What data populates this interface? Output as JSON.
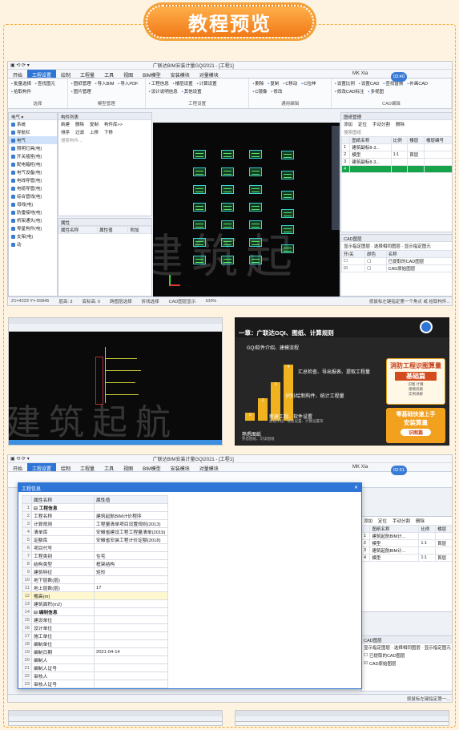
{
  "banner": {
    "title": "教程预览"
  },
  "shot1": {
    "window_title": "广联达BIM安装计量GQI2021 - [工程1]",
    "tabs": [
      "开始",
      "工程设置",
      "绘制",
      "工程量",
      "工具",
      "视图",
      "BIM模型",
      "安装模块",
      "对量模块"
    ],
    "active_tab": "工程设置",
    "user": "MK Xia",
    "time": "03:40",
    "ribbon_groups": [
      {
        "name": "选择",
        "items": [
          "批量选择",
          "查找图元",
          "拾取构件"
        ]
      },
      {
        "name": "模型管理",
        "items": [
          "图纸管理",
          "导入BIM",
          "导入PDF",
          "图片管理"
        ]
      },
      {
        "name": "工程设置",
        "items": [
          "工程信息",
          "楼层设置",
          "计算设置",
          "设计说明信息",
          "其他设置"
        ]
      },
      {
        "name": "通用编辑",
        "items": [
          "删除",
          "复制",
          "C移动",
          "C拉伸",
          "C镜像",
          "修改"
        ]
      },
      {
        "name": "CAD编辑",
        "items": [
          "设置比例",
          "设置CAD",
          "查找替换",
          "补画CAD",
          "修改CAD标注",
          "多视图"
        ]
      }
    ],
    "filters": [
      "电气"
    ],
    "tree": [
      "系统",
      "导航栏",
      "电气",
      "照明灯具(电)",
      "开关插座(电)",
      "配电箱柜(电)",
      "电气设备(电)",
      "电线导管(电)",
      "电缆导管(电)",
      "综合管线(电)",
      "母线(电)",
      "防雷接地(电)",
      "桥架通头(电)",
      "零星构件(电)",
      "支架(电)",
      "动"
    ],
    "component_list_title": "构件列表",
    "component_list_tools": [
      "新建",
      "删除",
      "复制",
      "构件库>>"
    ],
    "sort_tools": [
      "排序",
      "过滤",
      "上移",
      "下移"
    ],
    "search_placeholder": "搜索构件...",
    "property_title": "属性",
    "property_cols": [
      "属性名称",
      "属性值",
      "附加"
    ],
    "drawing_panel_title": "图纸管理",
    "drawing_tools": [
      "添加",
      "定位",
      "手动分割",
      "删除"
    ],
    "search_label": "搜索图纸",
    "drawing_cols": [
      "图纸名称",
      "比例",
      "楼层",
      "楼层编号"
    ],
    "drawing_rows": [
      {
        "n": "1",
        "name": "建筑副标8-3...",
        "scale": "",
        "floor": "",
        "code": ""
      },
      {
        "n": "2",
        "name": "模型",
        "scale": "1:1",
        "floor": "首层",
        "code": ""
      },
      {
        "n": "3",
        "name": "建筑副标8-3...",
        "scale": "",
        "floor": "",
        "code": ""
      },
      {
        "n": "4",
        "name": "",
        "scale": "",
        "floor": "",
        "code": ""
      }
    ],
    "cad_layer_title": "CAD图层",
    "cad_layer_opts": "显示指定图层 · 选择相同图层 · 显示指定图元",
    "cad_layer_cols": [
      "开/关",
      "颜色",
      "名称"
    ],
    "cad_layers": [
      "已提取的CAD图层",
      "CAD原始图层"
    ],
    "status": [
      "Z1=4223 Y=-55846",
      "层高: 3",
      "底标高: 0",
      "跨图层选择",
      "折线选择",
      "CAD图层显示",
      "100%"
    ],
    "status_right": "按鼠标左键指定第一个角点 或 拾取构件..."
  },
  "shot2": {
    "watermark": "建筑起航"
  },
  "shot3": {
    "header": "一章：广联达GQI、图纸、计算规则",
    "subheader": "GQI软件介绍、建模流程",
    "steps": [
      {
        "n": "1",
        "label": "熟悉图纸",
        "sub": "熟悉图纸、识读图纸"
      },
      {
        "n": "2",
        "label": "新建工程、软件设置",
        "sub": "新建工程、楼层设置、计算设置等"
      },
      {
        "n": "3",
        "label": "识别/绘制构件、统计工程量",
        "sub": ""
      },
      {
        "n": "4",
        "label": "汇总检查、导出报表、提取工程量",
        "sub": ""
      }
    ],
    "promo_title": "消防工程识图算量",
    "promo_sub": "基础篇",
    "promo_items": [
      "识图 计算",
      "建模思路",
      "实例讲解"
    ],
    "promo2_title": "零基础快速上手",
    "promo2_sub": "安装算量",
    "promo2_btn": "识图篇"
  },
  "shot4": {
    "window_title": "广联达BIM安装计量GQI2021 - [工程1]",
    "tabs": [
      "开始",
      "工程设置",
      "绘制",
      "工程量",
      "工具",
      "视图",
      "BIM模型",
      "安装模块",
      "对量模块"
    ],
    "user": "MK Xia",
    "time": "02:51",
    "dialog_title": "工程信息",
    "columns": [
      "属性名称",
      "属性值"
    ],
    "rows": [
      {
        "n": "1",
        "name": "工程信息",
        "val": "",
        "grp": true
      },
      {
        "n": "2",
        "name": "工程名称",
        "val": "建筑起航BIM计价程序"
      },
      {
        "n": "3",
        "name": "计算规则",
        "val": "工程量清单项目设置规则(2013)"
      },
      {
        "n": "4",
        "name": "清单库",
        "val": "安徽省建设工程工程量清单(2019)"
      },
      {
        "n": "5",
        "name": "定额库",
        "val": "安徽省安装工程计价定额(2018)"
      },
      {
        "n": "6",
        "name": "项目代号",
        "val": ""
      },
      {
        "n": "7",
        "name": "工程类别",
        "val": "住宅"
      },
      {
        "n": "8",
        "name": "结构类型",
        "val": "框架结构"
      },
      {
        "n": "9",
        "name": "建筑特征",
        "val": "矩形"
      },
      {
        "n": "10",
        "name": "地下层数(层)",
        "val": ""
      },
      {
        "n": "11",
        "name": "地上层数(层)",
        "val": "17"
      },
      {
        "n": "12",
        "name": "檐高(m)",
        "val": "",
        "hl": true
      },
      {
        "n": "13",
        "name": "建筑面积(m2)",
        "val": ""
      },
      {
        "n": "14",
        "name": "编制信息",
        "val": "",
        "grp": true
      },
      {
        "n": "15",
        "name": "建设单位",
        "val": ""
      },
      {
        "n": "16",
        "name": "设计单位",
        "val": ""
      },
      {
        "n": "17",
        "name": "施工单位",
        "val": ""
      },
      {
        "n": "18",
        "name": "编制单位",
        "val": ""
      },
      {
        "n": "19",
        "name": "编制日期",
        "val": "2021-04-14"
      },
      {
        "n": "20",
        "name": "编制人",
        "val": ""
      },
      {
        "n": "21",
        "name": "编制人证号",
        "val": ""
      },
      {
        "n": "22",
        "name": "审核人",
        "val": ""
      },
      {
        "n": "23",
        "name": "审核人证号",
        "val": ""
      }
    ],
    "drawing_cols": [
      "图纸名称",
      "比例",
      "楼层"
    ],
    "drawing_rows": [
      {
        "n": "1",
        "name": "建筑起航BIM计...",
        "scale": "",
        "floor": ""
      },
      {
        "n": "2",
        "name": "模型",
        "scale": "1:1",
        "floor": "首层"
      },
      {
        "n": "3",
        "name": "建筑起航BIM计...",
        "scale": "",
        "floor": ""
      },
      {
        "n": "4",
        "name": "模型",
        "scale": "1:1",
        "floor": "首层"
      }
    ],
    "drawing_tools": [
      "添加",
      "定位",
      "手动分割",
      "删除"
    ],
    "cad_layer_title": "CAD图层",
    "cad_layer_opts": "显示指定图层 · 选择相同图层 · 显示指定图元",
    "cad_layers": [
      "已提取的CAD图层",
      "CAD原始图层"
    ],
    "status_right": "按鼠标左键指定第一..."
  }
}
